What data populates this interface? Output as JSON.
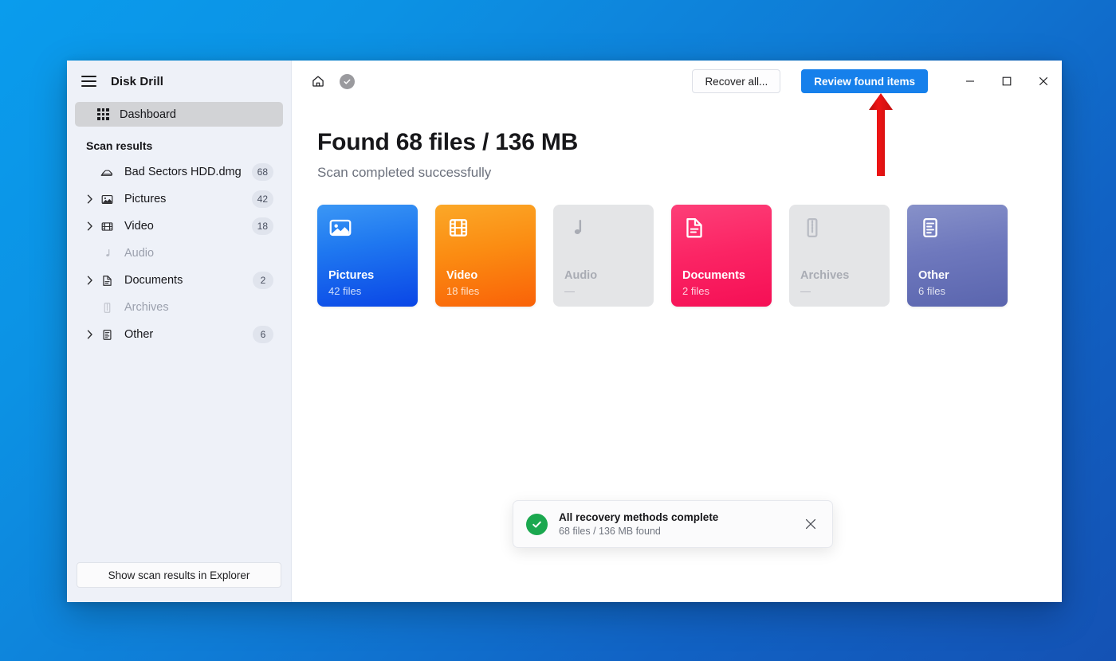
{
  "app": {
    "title": "Disk Drill"
  },
  "sidebar": {
    "menu_icon": "hamburger-icon",
    "dashboard": {
      "label": "Dashboard",
      "icon": "grid-icon"
    },
    "section_label": "Scan results",
    "tree": [
      {
        "label": "Bad Sectors HDD.dmg",
        "count": "68",
        "icon": "hard-drive-icon",
        "expandable": false,
        "muted": false
      },
      {
        "label": "Pictures",
        "count": "42",
        "icon": "image-icon",
        "expandable": true,
        "muted": false
      },
      {
        "label": "Video",
        "count": "18",
        "icon": "film-icon",
        "expandable": true,
        "muted": false
      },
      {
        "label": "Audio",
        "count": "",
        "icon": "music-icon",
        "expandable": false,
        "muted": true
      },
      {
        "label": "Documents",
        "count": "2",
        "icon": "document-icon",
        "expandable": true,
        "muted": false
      },
      {
        "label": "Archives",
        "count": "",
        "icon": "archive-icon",
        "expandable": false,
        "muted": true
      },
      {
        "label": "Other",
        "count": "6",
        "icon": "list-doc-icon",
        "expandable": true,
        "muted": false
      }
    ],
    "footer_button": "Show scan results in Explorer"
  },
  "topbar": {
    "home_icon": "home-icon",
    "status_icon": "check-circle-icon",
    "recover_all_label": "Recover all...",
    "review_label": "Review found items",
    "minimize_icon": "minimize-icon",
    "maximize_icon": "maximize-icon",
    "close_icon": "close-icon"
  },
  "main": {
    "headline": "Found 68 files / 136 MB",
    "subhead": "Scan completed successfully",
    "cards": [
      {
        "name": "Pictures",
        "count": "42 files",
        "icon": "image-icon",
        "color": "#1f78f0",
        "disabled": false
      },
      {
        "name": "Video",
        "count": "18 files",
        "icon": "film-icon",
        "color": "#fb8c12",
        "disabled": false
      },
      {
        "name": "Audio",
        "count": "—",
        "icon": "music-icon",
        "color": "#e4e5e7",
        "disabled": true
      },
      {
        "name": "Documents",
        "count": "2 files",
        "icon": "document-icon",
        "color": "#fb2464",
        "disabled": false
      },
      {
        "name": "Archives",
        "count": "—",
        "icon": "archive-icon",
        "color": "#e4e5e7",
        "disabled": true
      },
      {
        "name": "Other",
        "count": "6 files",
        "icon": "list-doc-icon",
        "color": "#6e78bd",
        "disabled": false
      }
    ]
  },
  "toast": {
    "icon": "success-check-icon",
    "title": "All recovery methods complete",
    "subtitle": "68 files / 136 MB found",
    "close_icon": "close-icon"
  },
  "annotation": {
    "arrow_color": "#e01b १"
  }
}
